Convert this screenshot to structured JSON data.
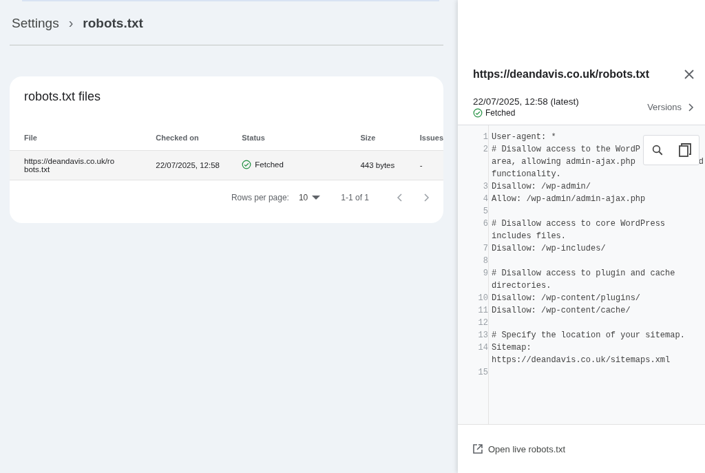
{
  "breadcrumb": {
    "parent": "Settings",
    "separator": "›",
    "current": "robots.txt"
  },
  "card": {
    "title": "robots.txt files",
    "columns": [
      "File",
      "Checked on",
      "Status",
      "Size",
      "Issues"
    ],
    "rows": [
      {
        "file": "https://deandavis.co.uk/ro\nbots.txt",
        "checked_on": "22/07/2025, 12:58",
        "status": "Fetched",
        "size": "443 bytes",
        "issues": "-"
      }
    ],
    "pagination": {
      "rows_per_page_label": "Rows per page:",
      "rows_per_page": "10",
      "range": "1-1 of 1"
    }
  },
  "panel": {
    "title": "https://deandavis.co.uk/robots.txt",
    "version_date": "22/07/2025, 12:58 (latest)",
    "status": "Fetched",
    "versions_label": "Versions",
    "code_lines": [
      {
        "number": "1",
        "rows": [
          "User-agent: *"
        ]
      },
      {
        "number": "2",
        "rows": [
          "# Disallow access to the WordP",
          "area, allowing admin-ajax.php",
          "functionality."
        ],
        "hidden_tail": "d"
      },
      {
        "number": "3",
        "rows": [
          "Disallow: /wp-admin/"
        ]
      },
      {
        "number": "4",
        "rows": [
          "Allow: /wp-admin/admin-ajax.php"
        ]
      },
      {
        "number": "5"
      },
      {
        "number": "6",
        "rows": [
          "# Disallow access to core WordPress",
          "includes files."
        ]
      },
      {
        "number": "7",
        "rows": [
          "Disallow: /wp-includes/"
        ]
      },
      {
        "number": "8"
      },
      {
        "number": "9",
        "rows": [
          "# Disallow access to plugin and cache",
          "directories."
        ]
      },
      {
        "number": "10",
        "rows": [
          "Disallow: /wp-content/plugins/"
        ]
      },
      {
        "number": "11",
        "rows": [
          "Disallow: /wp-content/cache/"
        ]
      },
      {
        "number": "12"
      },
      {
        "number": "13",
        "rows": [
          "# Specify the location of your sitemap."
        ]
      },
      {
        "number": "14",
        "rows": [
          "Sitemap:",
          "https://deandavis.co.uk/sitemaps.xml"
        ]
      },
      {
        "number": "15"
      }
    ],
    "open_live_label": "Open live robots.txt"
  }
}
